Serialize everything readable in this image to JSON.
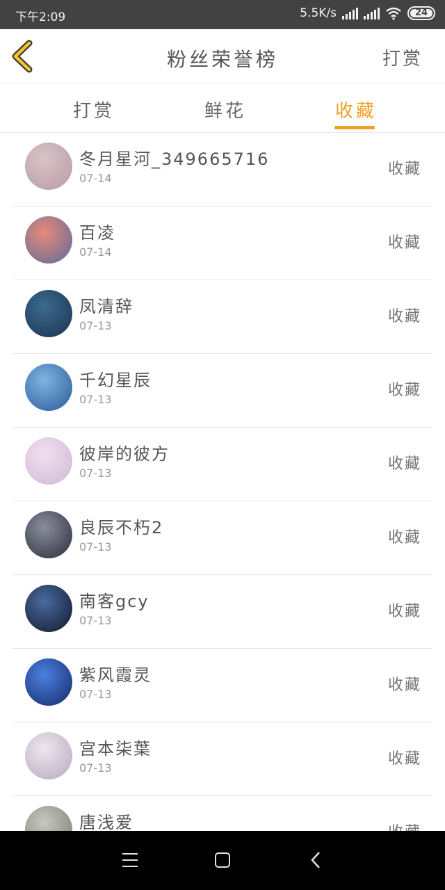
{
  "status_bar": {
    "time": "下午2:09",
    "net_speed": "5.5K/s",
    "battery": "24"
  },
  "header": {
    "title": "粉丝荣誉榜",
    "action": "打赏",
    "back_icon": "chevron-left-icon"
  },
  "tabs": [
    {
      "label": "打赏",
      "active": false
    },
    {
      "label": "鲜花",
      "active": false
    },
    {
      "label": "收藏",
      "active": true
    }
  ],
  "accent_color": "#f0a020",
  "fans": [
    {
      "name": "冬月星河_349665716",
      "date": "07-14",
      "action": "收藏",
      "avatar_colors": [
        "#d8c4c8",
        "#b89aa4"
      ]
    },
    {
      "name": "百凌",
      "date": "07-14",
      "action": "收藏",
      "avatar_colors": [
        "#e88a7a",
        "#5a6a9a"
      ]
    },
    {
      "name": "凤清辞",
      "date": "07-13",
      "action": "收藏",
      "avatar_colors": [
        "#3a6a8e",
        "#1c3450"
      ]
    },
    {
      "name": "千幻星辰",
      "date": "07-13",
      "action": "收藏",
      "avatar_colors": [
        "#7fb4e0",
        "#2c5a9a"
      ]
    },
    {
      "name": "彼岸的彼方",
      "date": "07-13",
      "action": "收藏",
      "avatar_colors": [
        "#f0e0ee",
        "#d0b8d8"
      ]
    },
    {
      "name": "良辰不朽2",
      "date": "07-13",
      "action": "收藏",
      "avatar_colors": [
        "#8a8e9c",
        "#2c2c3a"
      ]
    },
    {
      "name": "南客gcy",
      "date": "07-13",
      "action": "收藏",
      "avatar_colors": [
        "#4a6a9e",
        "#10182c"
      ]
    },
    {
      "name": "紫风霞灵",
      "date": "07-13",
      "action": "收藏",
      "avatar_colors": [
        "#4a80e0",
        "#162a6a"
      ]
    },
    {
      "name": "宫本柒葉",
      "date": "07-13",
      "action": "收藏",
      "avatar_colors": [
        "#ece6ee",
        "#b8a8c0"
      ]
    },
    {
      "name": "唐浅爱",
      "date": "",
      "action": "收藏",
      "avatar_colors": [
        "#c8c8c0",
        "#7a7a70"
      ]
    }
  ]
}
